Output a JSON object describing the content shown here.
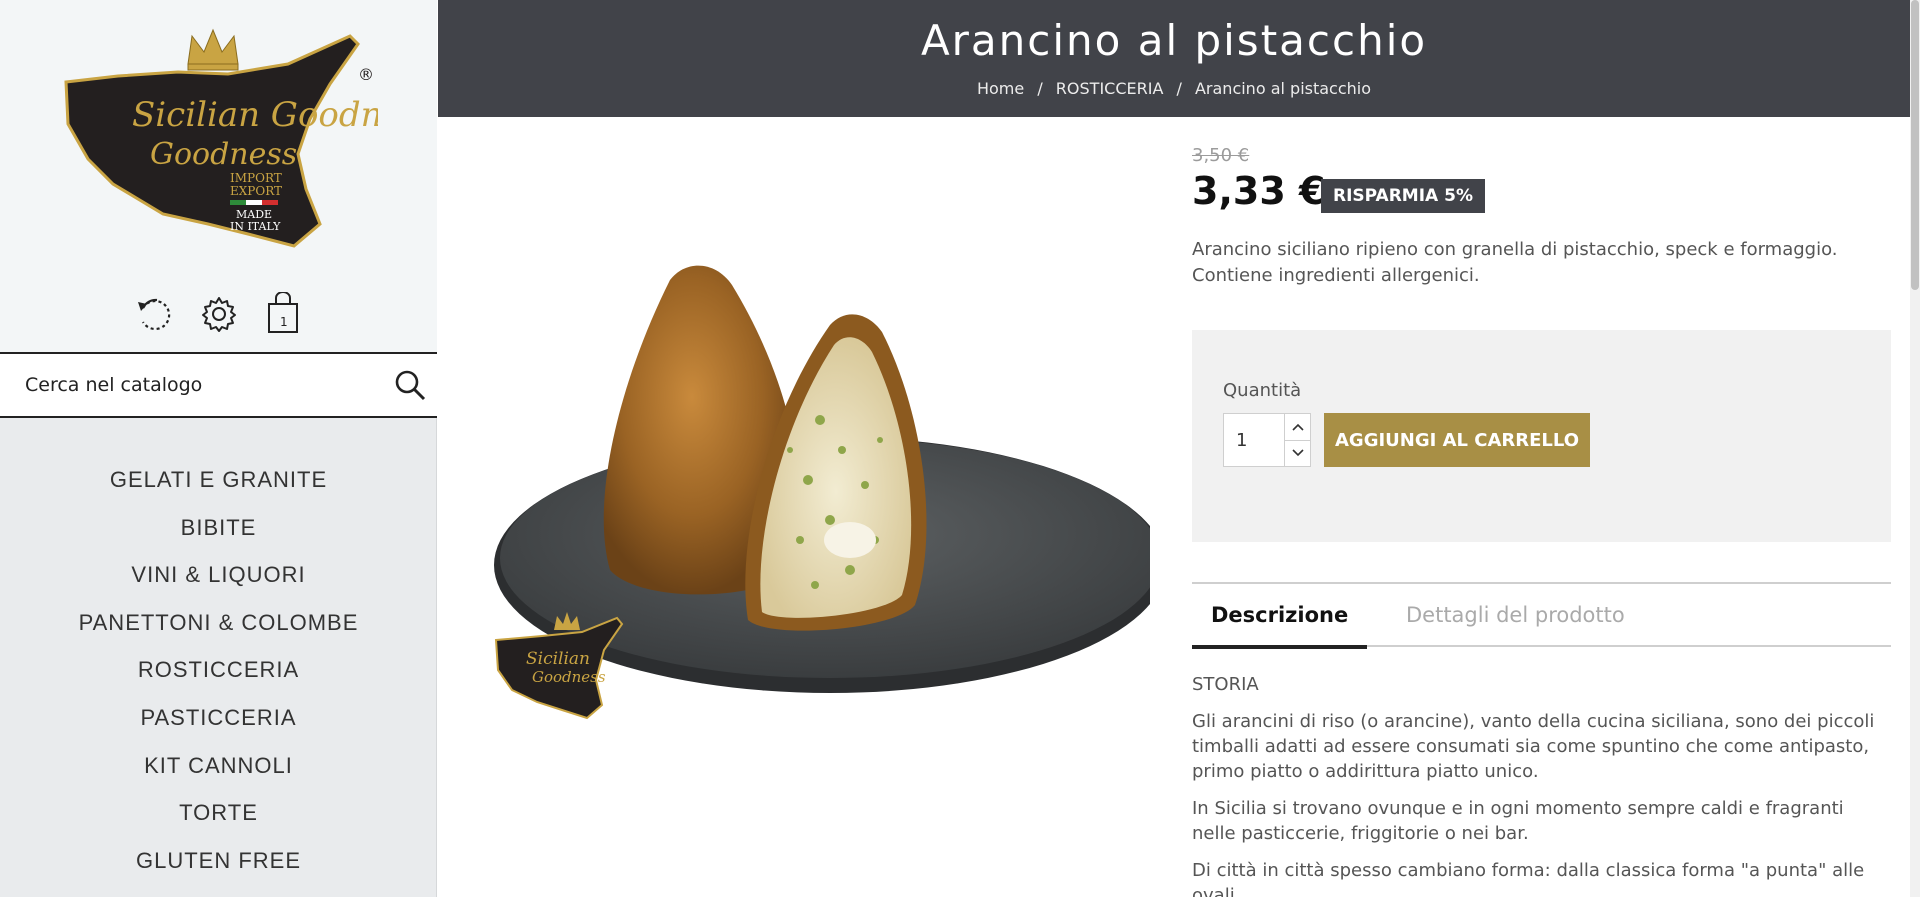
{
  "brand": {
    "logo_name": "Sicilian Goodness",
    "logo_tagline_1": "IMPORT",
    "logo_tagline_2": "EXPORT",
    "logo_tagline_3": "MADE",
    "logo_tagline_4": "IN ITALY",
    "registered": "®"
  },
  "user_bar": {
    "history_icon": "history-icon",
    "settings_icon": "gear-icon",
    "cart_icon": "shopping-bag-icon",
    "cart_count": "1"
  },
  "search": {
    "placeholder": "Cerca nel catalogo",
    "icon": "search-icon"
  },
  "menu": [
    {
      "label": "GELATI E GRANITE"
    },
    {
      "label": "BIBITE"
    },
    {
      "label": "VINI & LIQUORI"
    },
    {
      "label": "PANETTONI & COLOMBE"
    },
    {
      "label": "ROSTICCERIA"
    },
    {
      "label": "PASTICCERIA"
    },
    {
      "label": "KIT CANNOLI"
    },
    {
      "label": "TORTE"
    },
    {
      "label": "GLUTEN FREE"
    }
  ],
  "header": {
    "title": "Arancino al pistacchio",
    "breadcrumb": [
      {
        "label": "Home"
      },
      {
        "label": "ROSTICCERIA"
      },
      {
        "label": "Arancino al pistacchio"
      }
    ],
    "separator": "/"
  },
  "product": {
    "old_price": "3,50 €",
    "price": "3,33 €",
    "discount_label": "RISPARMIA 5%",
    "short_description": "Arancino siciliano ripieno con granella di pistacchio, speck e formaggio. Contiene ingredienti allergenici.",
    "quantity_label": "Quantità",
    "quantity_value": "1",
    "add_to_cart": "AGGIUNGI AL CARRELLO",
    "tabs": [
      {
        "label": "Descrizione"
      },
      {
        "label": "Dettagli del prodotto"
      }
    ],
    "description": {
      "heading": "STORIA",
      "p1": "Gli arancini di riso (o arancine), vanto della cucina siciliana, sono dei piccoli timballi adatti ad essere consumati sia come spuntino che come antipasto, primo piatto o addirittura piatto unico.",
      "p2": "In Sicilia si trovano ovunque e in ogni momento sempre caldi e fragranti nelle pasticcerie, friggitorie o nei bar.",
      "p3": "Di città in città spesso cambiano forma: dalla classica forma \"a punta\" alle ovali"
    }
  },
  "colors": {
    "header_bg": "#414349",
    "accent_gold": "#a88f45",
    "sidebar_bg": "#e9ebed"
  }
}
